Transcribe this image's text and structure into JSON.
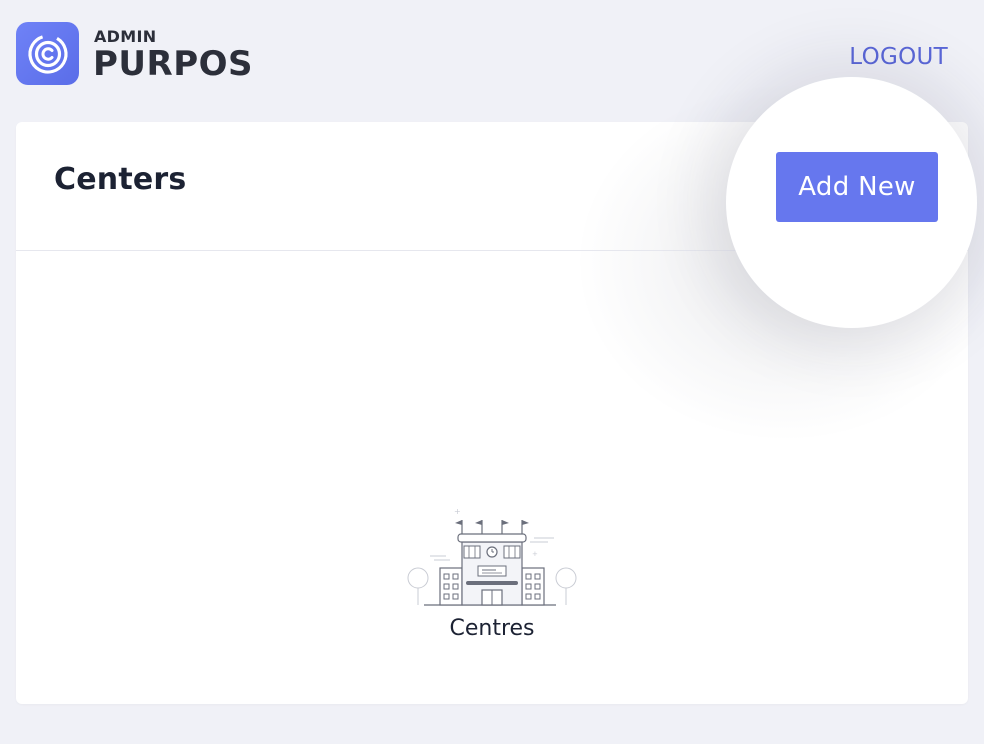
{
  "brand": {
    "small": "ADMIN",
    "name": "PURPOS"
  },
  "header": {
    "logout_label": "LOGOUT"
  },
  "page": {
    "title": "Centers",
    "add_button_label": "Add New"
  },
  "empty_state": {
    "label": "Centres",
    "icon": "building-illustration"
  },
  "colors": {
    "accent": "#6677ee",
    "logout": "#5a67d8",
    "background": "#f0f1f7"
  }
}
